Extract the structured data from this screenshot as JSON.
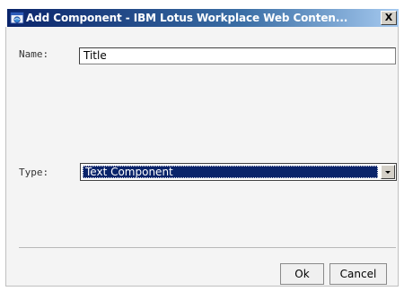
{
  "window": {
    "title": "Add Component - IBM Lotus Workplace Web Conten...",
    "close_glyph": "X"
  },
  "form": {
    "name_label": "Name:",
    "name_value": "Title",
    "type_label": "Type:",
    "type_value": "Text Component"
  },
  "buttons": {
    "ok": "Ok",
    "cancel": "Cancel"
  },
  "icons": {
    "title": "browser-window-icon",
    "dropdown": "chevron-down-icon"
  },
  "colors": {
    "titlebar_start": "#0a246a",
    "titlebar_end": "#a6caf0",
    "selection": "#0a246a",
    "body_bg": "#f4f4f4"
  }
}
